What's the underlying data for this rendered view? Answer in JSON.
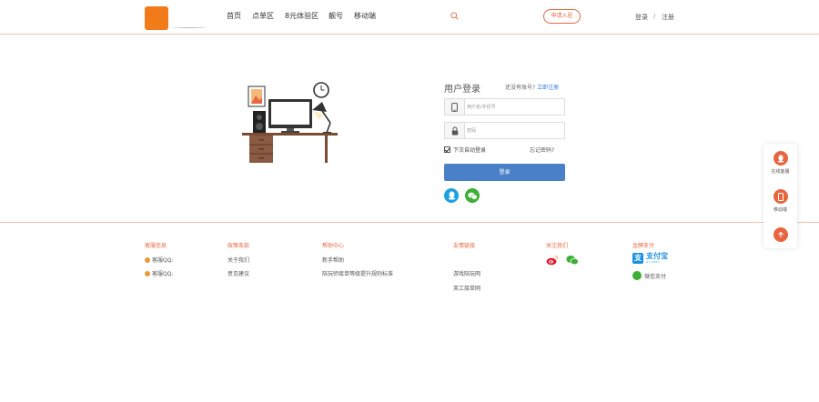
{
  "header": {
    "logo_badge": "",
    "logo_name": "",
    "logo_tagline": "",
    "nav": [
      "首页",
      "点单区",
      "8元体验区",
      "靓号",
      "移动端"
    ],
    "search_placeholder": "",
    "apply_label": "申请入驻",
    "login_label": "登录",
    "separator": "/",
    "register_label": "注册"
  },
  "login": {
    "title": "用户登录",
    "no_account_text": "还没有账号?",
    "register_now": "立即注册",
    "username_placeholder": "用户名/手机号",
    "password_placeholder": "密码",
    "remember_label": "下次自动登录",
    "forgot_label": "忘记密码?",
    "submit_label": "登录"
  },
  "footer": {
    "columns": [
      {
        "title": "客服信息",
        "items": [
          "客服QQ:",
          "客服QQ:"
        ]
      },
      {
        "title": "政策条款",
        "items": [
          "关于我们",
          "意见建议"
        ]
      },
      {
        "title": "帮助中心",
        "items": [
          "新手帮助",
          "陪玩师接单等级提升规则标准"
        ]
      },
      {
        "title": "友情链接",
        "items": [
          "",
          "游戏陪玩网",
          "英工接单网"
        ]
      },
      {
        "title": "关注我们",
        "items": []
      },
      {
        "title": "金牌支付",
        "items": []
      }
    ],
    "alipay_text": "支付宝",
    "alipay_sub": "ALIPAY",
    "wechat_pay": "微信支付",
    "copyright": "",
    "tips": ""
  },
  "sidebar": {
    "service_label": "在线客服",
    "mobile_label": "移动端"
  },
  "colors": {
    "brand_orange": "#f07b18",
    "accent": "#e8663f",
    "button_blue": "#4a80c8",
    "qq_blue": "#1aa1e0",
    "wechat_green": "#3cb034"
  }
}
